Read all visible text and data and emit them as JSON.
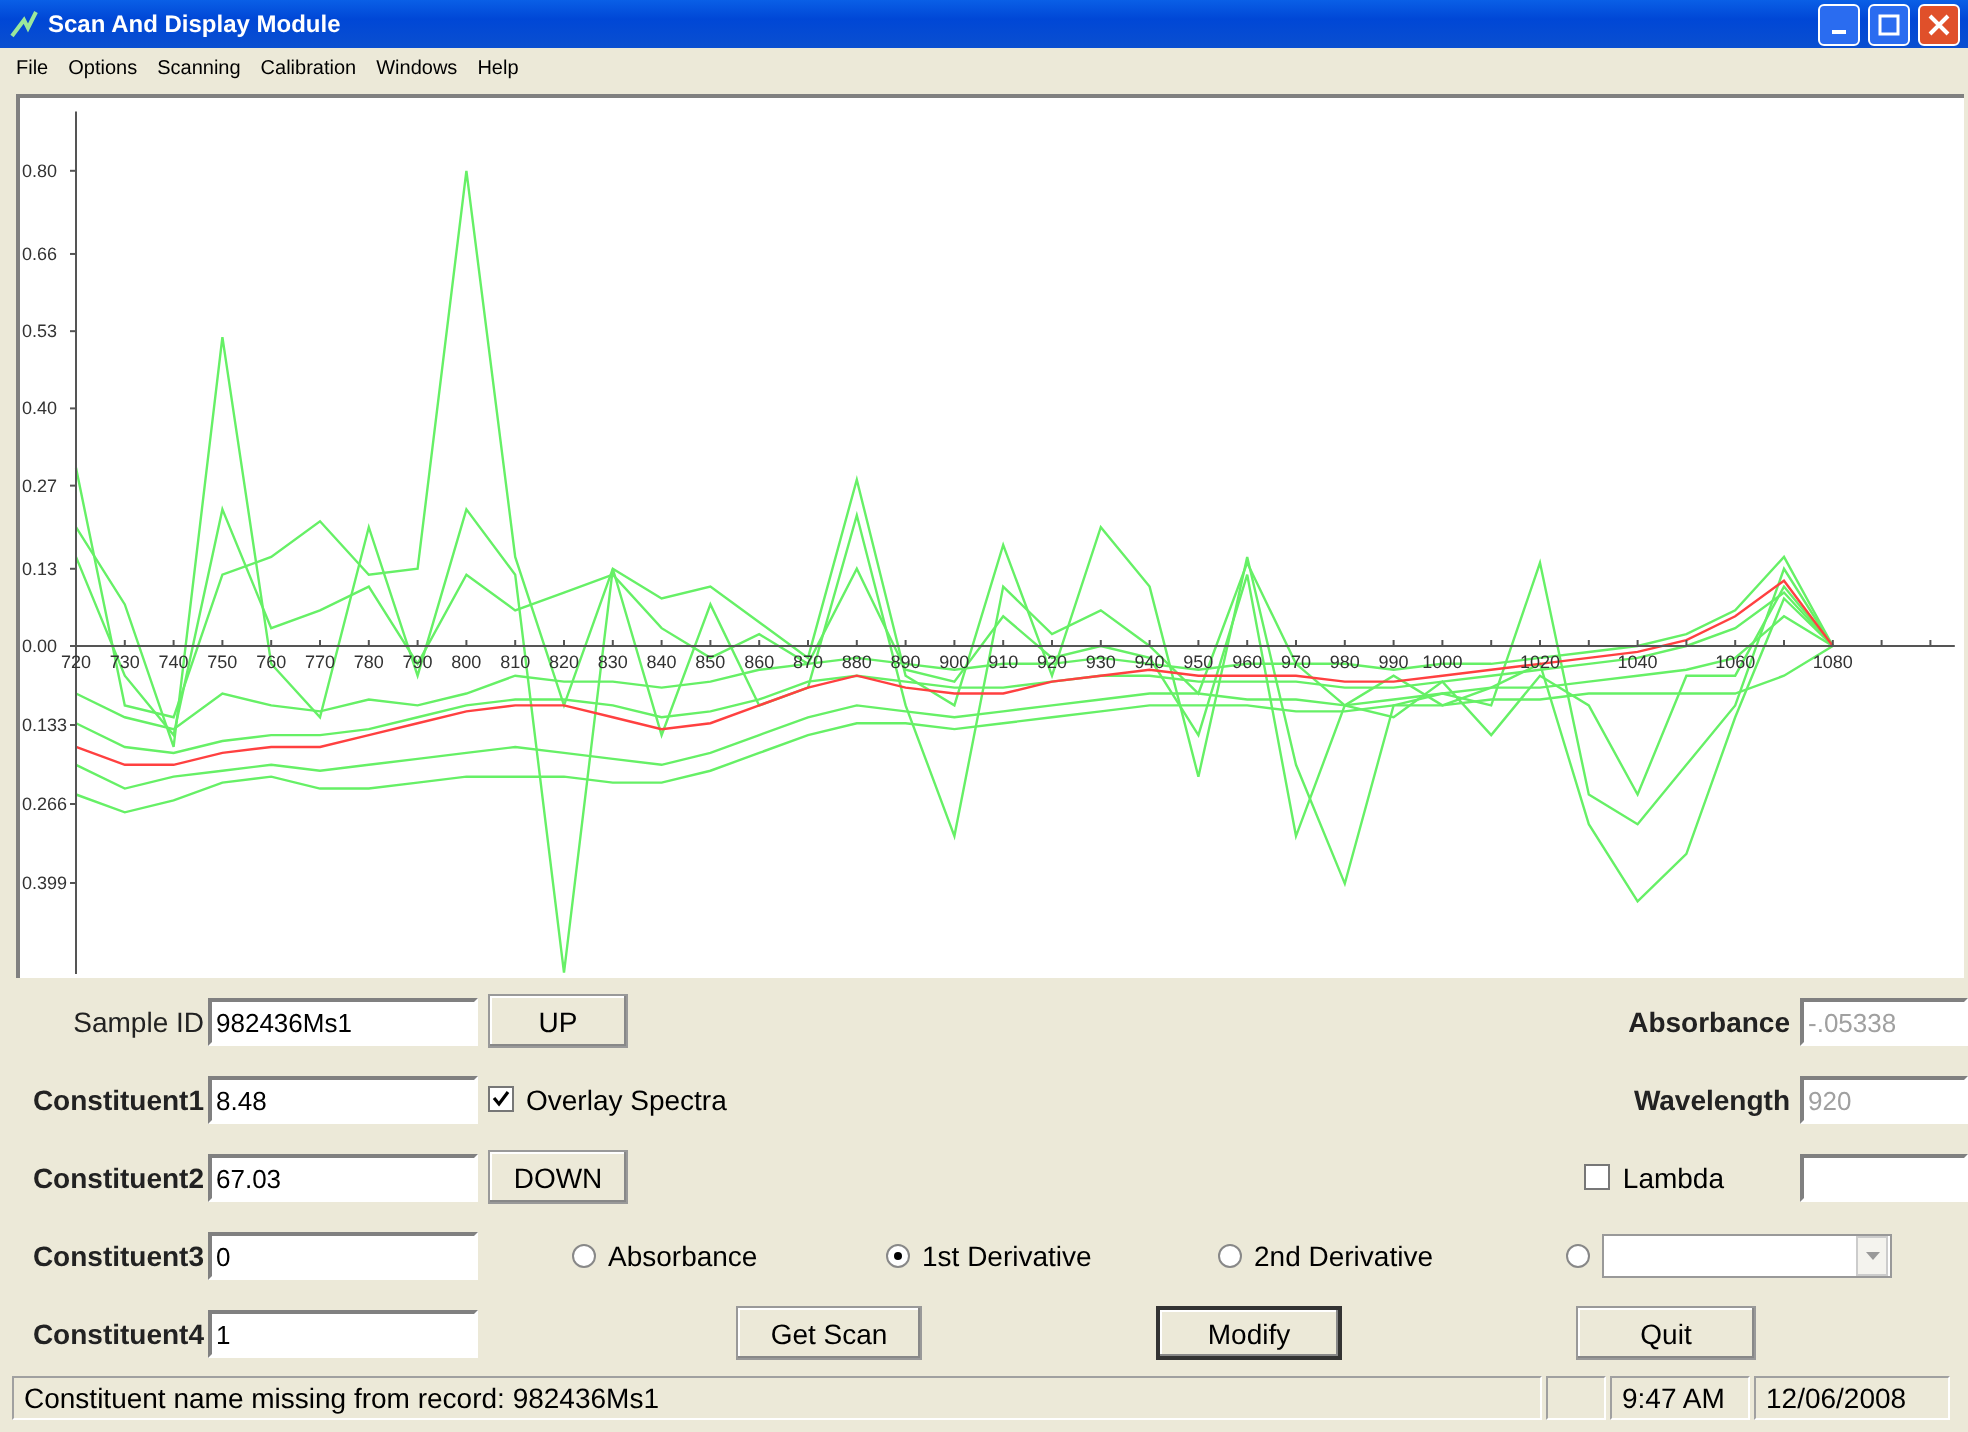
{
  "window": {
    "title": "Scan And Display Module"
  },
  "menu": [
    "File",
    "Options",
    "Scanning",
    "Calibration",
    "Windows",
    "Help"
  ],
  "chart": {
    "chart_data": {
      "type": "line",
      "xlim": [
        720,
        1105
      ],
      "ylim": [
        -0.56,
        0.9
      ],
      "x": [
        720,
        730,
        740,
        750,
        760,
        770,
        780,
        790,
        800,
        810,
        820,
        830,
        840,
        850,
        860,
        870,
        880,
        890,
        900,
        910,
        920,
        930,
        940,
        950,
        960,
        970,
        980,
        990,
        1000,
        1010,
        1020,
        1030,
        1040,
        1050,
        1060,
        1070,
        1080
      ],
      "xticks": [
        720,
        730,
        740,
        750,
        760,
        770,
        780,
        790,
        800,
        810,
        820,
        830,
        840,
        850,
        860,
        870,
        880,
        890,
        900,
        910,
        920,
        930,
        940,
        950,
        960,
        970,
        980,
        990,
        1000,
        1020,
        1040,
        1060,
        1080
      ],
      "yticks": [
        {
          "value": 0.8,
          "label": "0.80"
        },
        {
          "value": 0.66,
          "label": "0.66"
        },
        {
          "value": 0.53,
          "label": "0.53"
        },
        {
          "value": 0.4,
          "label": "0.40"
        },
        {
          "value": 0.27,
          "label": "0.27"
        },
        {
          "value": 0.13,
          "label": "0.13"
        },
        {
          "value": 0,
          "label": "0.00"
        },
        {
          "value": -0.133,
          "label": "0.133"
        },
        {
          "value": -0.266,
          "label": "0.266"
        },
        {
          "value": -0.399,
          "label": "0.399"
        }
      ],
      "series": [
        {
          "color": "#66f066",
          "values": [
            0.3,
            -0.1,
            -0.12,
            0.12,
            0.15,
            0.21,
            0.12,
            0.13,
            0.8,
            0.15,
            -0.1,
            0.13,
            0.08,
            0.1,
            0.04,
            -0.02,
            0.28,
            -0.05,
            -0.1,
            0.17,
            -0.05,
            0.2,
            0.1,
            -0.22,
            0.15,
            -0.2,
            -0.4,
            -0.1,
            -0.08,
            -0.1,
            0.14,
            -0.25,
            -0.3,
            -0.2,
            -0.1,
            0.13,
            0.0
          ]
        },
        {
          "color": "#66f066",
          "values": [
            0.2,
            0.07,
            -0.17,
            0.52,
            -0.03,
            -0.12,
            0.2,
            -0.05,
            0.23,
            0.12,
            -0.55,
            0.13,
            -0.15,
            0.07,
            -0.1,
            -0.07,
            0.22,
            -0.1,
            -0.32,
            0.1,
            0.02,
            0.06,
            0.0,
            -0.08,
            0.14,
            -0.03,
            -0.1,
            -0.12,
            -0.06,
            -0.15,
            -0.05,
            -0.1,
            -0.25,
            -0.05,
            -0.05,
            0.1,
            0.0
          ]
        },
        {
          "color": "#66f066",
          "values": [
            0.15,
            -0.05,
            -0.15,
            0.23,
            0.03,
            0.06,
            0.1,
            -0.03,
            0.12,
            0.06,
            0.09,
            0.12,
            0.03,
            -0.02,
            0.02,
            -0.03,
            0.13,
            -0.04,
            -0.06,
            0.05,
            -0.02,
            0.0,
            -0.02,
            -0.15,
            0.12,
            -0.32,
            -0.1,
            -0.05,
            -0.1,
            -0.07,
            -0.03,
            -0.3,
            -0.43,
            -0.35,
            -0.12,
            0.08,
            0.0
          ]
        },
        {
          "color": "#66f066",
          "values": [
            -0.25,
            -0.28,
            -0.26,
            -0.23,
            -0.22,
            -0.24,
            -0.24,
            -0.23,
            -0.22,
            -0.22,
            -0.22,
            -0.23,
            -0.23,
            -0.21,
            -0.18,
            -0.15,
            -0.13,
            -0.13,
            -0.14,
            -0.13,
            -0.12,
            -0.11,
            -0.1,
            -0.1,
            -0.1,
            -0.11,
            -0.11,
            -0.1,
            -0.1,
            -0.09,
            -0.09,
            -0.08,
            -0.08,
            -0.08,
            -0.08,
            -0.05,
            0.0
          ]
        },
        {
          "color": "#66f066",
          "values": [
            -0.13,
            -0.17,
            -0.18,
            -0.16,
            -0.15,
            -0.15,
            -0.14,
            -0.12,
            -0.1,
            -0.09,
            -0.09,
            -0.1,
            -0.12,
            -0.11,
            -0.09,
            -0.06,
            -0.05,
            -0.06,
            -0.07,
            -0.07,
            -0.06,
            -0.05,
            -0.05,
            -0.06,
            -0.06,
            -0.06,
            -0.07,
            -0.07,
            -0.06,
            -0.05,
            -0.04,
            -0.03,
            -0.02,
            0.0,
            0.03,
            0.09,
            0.0
          ]
        },
        {
          "color": "#66f066",
          "values": [
            -0.2,
            -0.24,
            -0.22,
            -0.21,
            -0.2,
            -0.21,
            -0.2,
            -0.19,
            -0.18,
            -0.17,
            -0.18,
            -0.19,
            -0.2,
            -0.18,
            -0.15,
            -0.12,
            -0.1,
            -0.11,
            -0.12,
            -0.11,
            -0.1,
            -0.09,
            -0.08,
            -0.08,
            -0.09,
            -0.09,
            -0.1,
            -0.09,
            -0.08,
            -0.07,
            -0.07,
            -0.06,
            -0.05,
            -0.04,
            -0.02,
            0.05,
            0.0
          ]
        },
        {
          "color": "#66f066",
          "values": [
            -0.08,
            -0.12,
            -0.14,
            -0.08,
            -0.1,
            -0.11,
            -0.09,
            -0.1,
            -0.08,
            -0.05,
            -0.06,
            -0.06,
            -0.07,
            -0.06,
            -0.04,
            -0.03,
            -0.02,
            -0.03,
            -0.04,
            -0.03,
            -0.03,
            -0.02,
            -0.03,
            -0.04,
            -0.03,
            -0.03,
            -0.03,
            -0.04,
            -0.03,
            -0.03,
            -0.02,
            -0.01,
            0.0,
            0.02,
            0.06,
            0.15,
            0.0
          ]
        },
        {
          "color": "#ff4040",
          "values": [
            -0.17,
            -0.2,
            -0.2,
            -0.18,
            -0.17,
            -0.17,
            -0.15,
            -0.13,
            -0.11,
            -0.1,
            -0.1,
            -0.12,
            -0.14,
            -0.13,
            -0.1,
            -0.07,
            -0.05,
            -0.07,
            -0.08,
            -0.08,
            -0.06,
            -0.05,
            -0.04,
            -0.05,
            -0.05,
            -0.05,
            -0.06,
            -0.06,
            -0.05,
            -0.04,
            -0.03,
            -0.02,
            -0.01,
            0.01,
            0.05,
            0.11,
            0.0
          ]
        }
      ]
    }
  },
  "form": {
    "sample_id": {
      "label": "Sample ID",
      "value": "982436Ms1"
    },
    "constituents": [
      {
        "label": "Constituent1",
        "value": "8.48"
      },
      {
        "label": "Constituent2",
        "value": "67.03"
      },
      {
        "label": "Constituent3",
        "value": "0"
      },
      {
        "label": "Constituent4",
        "value": "1"
      }
    ],
    "up_button": "UP",
    "down_button": "DOWN",
    "overlay_spectra": {
      "label": "Overlay Spectra",
      "checked": true
    },
    "absorbance": {
      "label": "Absorbance",
      "value": "-.05338",
      "disabled": true
    },
    "wavelength": {
      "label": "Wavelength",
      "value": "920",
      "disabled": true
    },
    "lambda": {
      "label": "Lambda",
      "checked": false
    },
    "display_mode": [
      {
        "kind": "radio",
        "label": "Absorbance",
        "selected": false
      },
      {
        "kind": "radio",
        "label": "1st Derivative",
        "selected": true
      },
      {
        "kind": "radio",
        "label": "2nd Derivative",
        "selected": false
      },
      {
        "kind": "combo",
        "selected": false
      }
    ],
    "actions": [
      {
        "label": "Get Scan",
        "default": false
      },
      {
        "label": "Modify",
        "default": true
      },
      {
        "label": "Quit",
        "default": false
      }
    ]
  },
  "status_bar": {
    "message": "Constituent name missing from record: 982436Ms1",
    "time": "9:47 AM",
    "date": "12/06/2008"
  }
}
